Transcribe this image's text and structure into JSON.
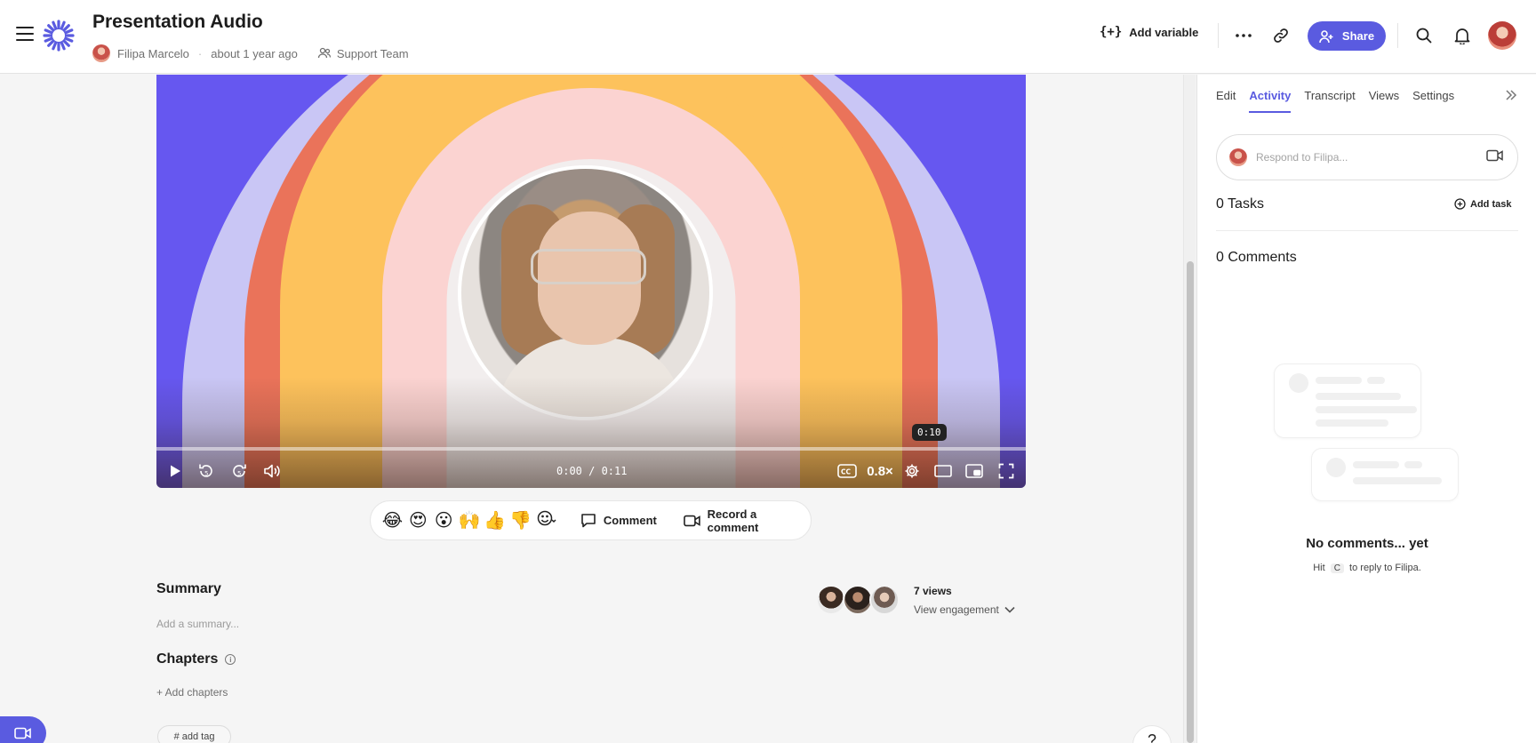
{
  "header": {
    "title": "Presentation Audio",
    "author": "Filipa Marcelo",
    "timestamp": "about 1 year ago",
    "team": "Support Team",
    "add_variable_label": "Add variable",
    "share_label": "Share"
  },
  "player": {
    "time_display": "0:00 / 0:11",
    "hover_time": "0:10",
    "speed": "0.8×",
    "progress": 0
  },
  "reactions": {
    "emojis": [
      "😂",
      "😍",
      "😮",
      "🙌",
      "👍",
      "👎"
    ],
    "comment_label": "Comment",
    "record_label": "Record a comment"
  },
  "summary": {
    "title": "Summary",
    "placeholder": "Add a summary..."
  },
  "chapters": {
    "title": "Chapters",
    "add_label": "+ Add chapters"
  },
  "tags": {
    "add_label": "# add tag"
  },
  "engagement": {
    "views": "7 views",
    "view_label": "View engagement"
  },
  "help": {
    "label": "?"
  },
  "panel": {
    "tabs": [
      "Edit",
      "Activity",
      "Transcript",
      "Views",
      "Settings"
    ],
    "active_tab": "Activity",
    "respond_placeholder": "Respond to Filipa...",
    "tasks_title": "0 Tasks",
    "add_task_label": "Add task",
    "comments_title": "0 Comments",
    "empty_title": "No comments... yet",
    "empty_hint_prefix": "Hit",
    "empty_hint_key": "C",
    "empty_hint_suffix": "to reply to Filipa."
  },
  "colors": {
    "accent": "#5a5be0",
    "arch_outer": "#6657f0",
    "arch_lavender": "#c9c6f5",
    "arch_coral": "#ea735a",
    "arch_yellow": "#fdc25c",
    "arch_pink": "#fbd3d1"
  }
}
